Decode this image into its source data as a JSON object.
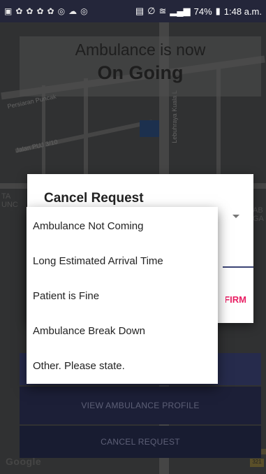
{
  "status_bar": {
    "battery": "74%",
    "time": "1:48 a.m.",
    "left_icons": [
      "message-icon",
      "app-icon",
      "app-icon",
      "app-icon",
      "app-icon",
      "sync-icon",
      "cloud-icon",
      "sync-icon"
    ],
    "right_icons": [
      "nfc-icon",
      "mute-icon",
      "wifi-icon",
      "signal-icon",
      "battery-icon"
    ]
  },
  "map": {
    "labels": {
      "persiaran": "Persiaran Puncak",
      "jalan": "Jalan PUJ 3/10",
      "lebuhraya": "Lebuhraya Kuala L",
      "left_edge": "TA\nUNC",
      "right_edge": "AB\nGA"
    },
    "google_logo": "Google",
    "scale_label": "321"
  },
  "banner": {
    "line1": "Ambulance is now",
    "line2": "On Going"
  },
  "buttons": {
    "view_profile": "VIEW AMBULANCE PROFILE",
    "cancel_request": "CANCEL REQUEST"
  },
  "dialog": {
    "title": "Cancel Request",
    "confirm_label": "CONFIRM",
    "options": [
      "Ambulance Not Coming",
      "Long Estimated Arrival Time",
      "Patient is Fine",
      "Ambulance Break Down",
      "Other. Please state."
    ]
  },
  "colors": {
    "status_bar": "#24263a",
    "button_primary": "#3b4375",
    "accent": "#e91e63"
  }
}
